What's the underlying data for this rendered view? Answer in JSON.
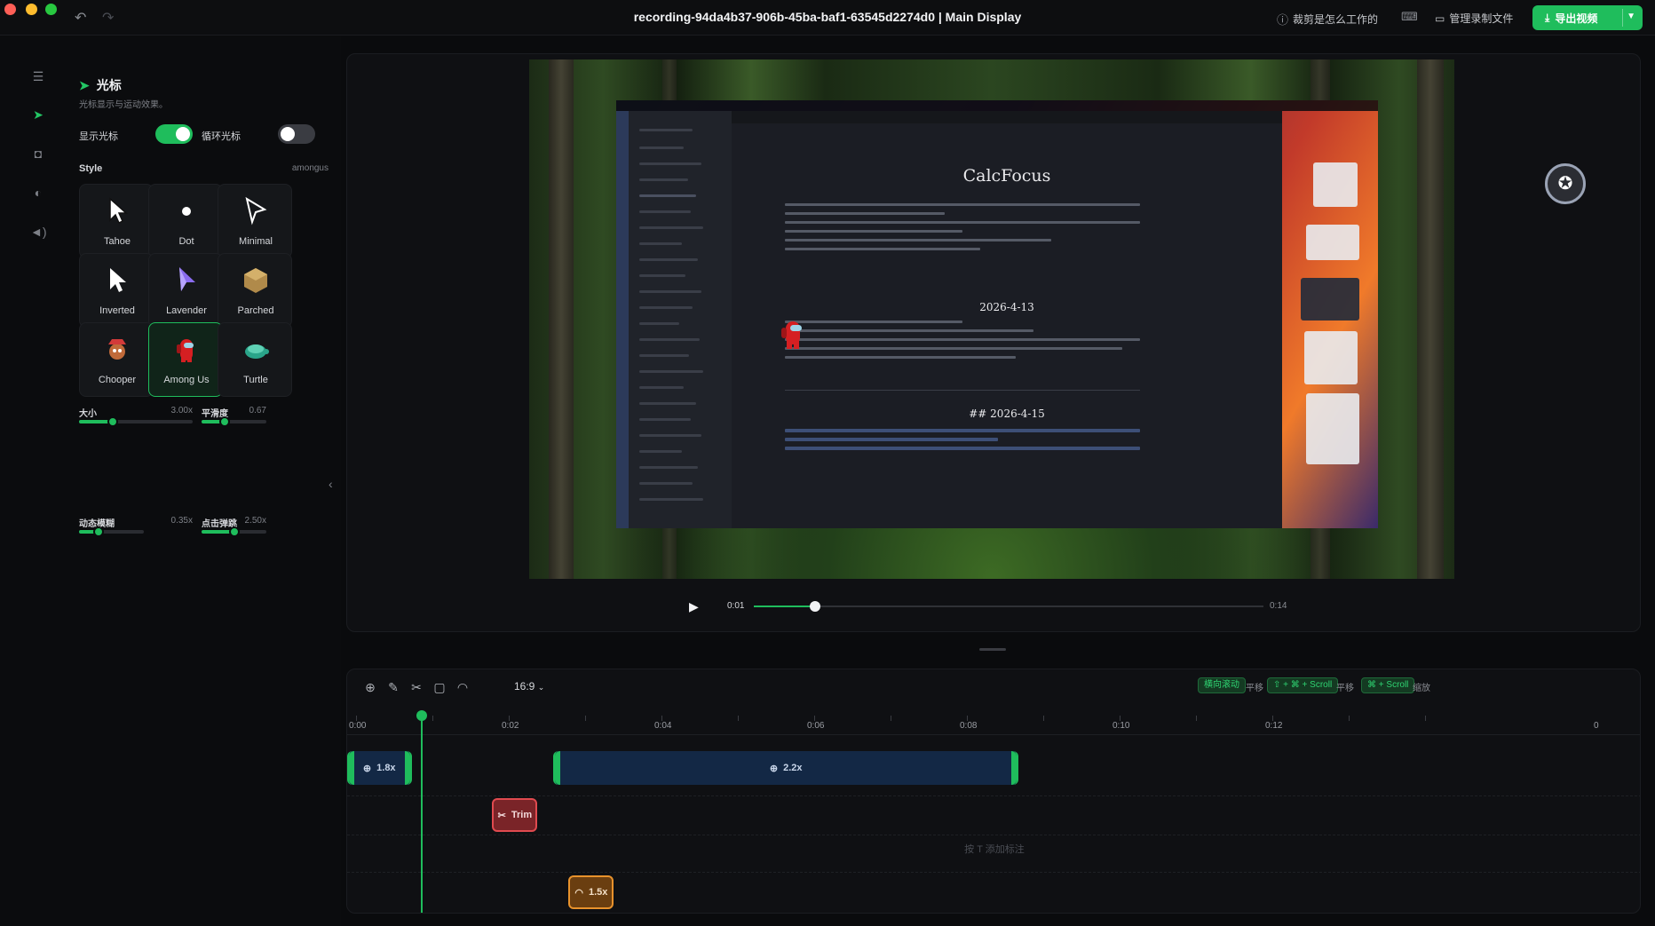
{
  "titlebar": {
    "title": "recording-94da4b37-906b-45ba-baf1-63545d2274d0 | Main Display",
    "help_label": "裁剪是怎么工作的",
    "manage_label": "管理录制文件",
    "export_label": "导出视频"
  },
  "panel": {
    "title": "光标",
    "subtitle": "光标显示与运动效果。",
    "show_cursor_label": "显示光标",
    "loop_cursor_label": "循环光标",
    "show_cursor_on": true,
    "loop_cursor_on": false,
    "style_label": "Style",
    "style_value": "amongus",
    "styles": [
      {
        "label": "Tahoe",
        "icon": "tahoe-cursor-icon"
      },
      {
        "label": "Dot",
        "icon": "dot-cursor-icon"
      },
      {
        "label": "Minimal",
        "icon": "minimal-cursor-icon"
      },
      {
        "label": "Inverted",
        "icon": "inverted-cursor-icon"
      },
      {
        "label": "Lavender",
        "icon": "lavender-cursor-icon"
      },
      {
        "label": "Parched",
        "icon": "parched-cursor-icon"
      },
      {
        "label": "Chooper",
        "icon": "chooper-cursor-icon"
      },
      {
        "label": "Among Us",
        "icon": "among-us-cursor-icon",
        "selected": true
      },
      {
        "label": "Turtle",
        "icon": "turtle-cursor-icon"
      }
    ],
    "sliders": [
      {
        "label": "大小",
        "value": "3.00x",
        "level": 0.3
      },
      {
        "label": "平滑度",
        "value": "0.67",
        "level": 0.35
      },
      {
        "label": "动态模糊",
        "value": "0.35x",
        "level": 0.3
      },
      {
        "label": "点击弹跳",
        "value": "2.50x",
        "level": 0.5
      }
    ]
  },
  "preview": {
    "doc_title": "CalcFocus",
    "heading_1": "2026-4-13",
    "heading_2": "## 2026-4-15"
  },
  "player": {
    "current_time": "0:01",
    "total_time": "0:14",
    "progress": 0.12
  },
  "timeline": {
    "aspect_ratio": "16:9",
    "shortcuts": [
      {
        "key": "横向滚动",
        "desc": "平移"
      },
      {
        "key": "⇧ + ⌘ + Scroll",
        "desc": "平移"
      },
      {
        "key": "⌘ + Scroll",
        "desc": "缩放"
      }
    ],
    "ticks": [
      "0:00",
      "0:02",
      "0:04",
      "0:06",
      "0:08",
      "0:10",
      "0:12",
      "0"
    ],
    "zoom_clips": [
      {
        "label": "1.8x",
        "start": 0.0,
        "end": 0.75
      },
      {
        "label": "2.2x",
        "start": 2.7,
        "end": 8.7
      }
    ],
    "trim_clip": {
      "label": "Trim",
      "start": 1.9,
      "end": 2.4
    },
    "speed_clip": {
      "label": "1.5x",
      "start": 2.9,
      "end": 3.4
    },
    "annotation_placeholder": "按 T 添加标注",
    "playhead_time": 0.97
  },
  "colors": {
    "accent": "#1fbd5c",
    "zoom_clip": "#132845",
    "trim_clip": "#7a2428",
    "speed_clip": "#6a3e10"
  }
}
